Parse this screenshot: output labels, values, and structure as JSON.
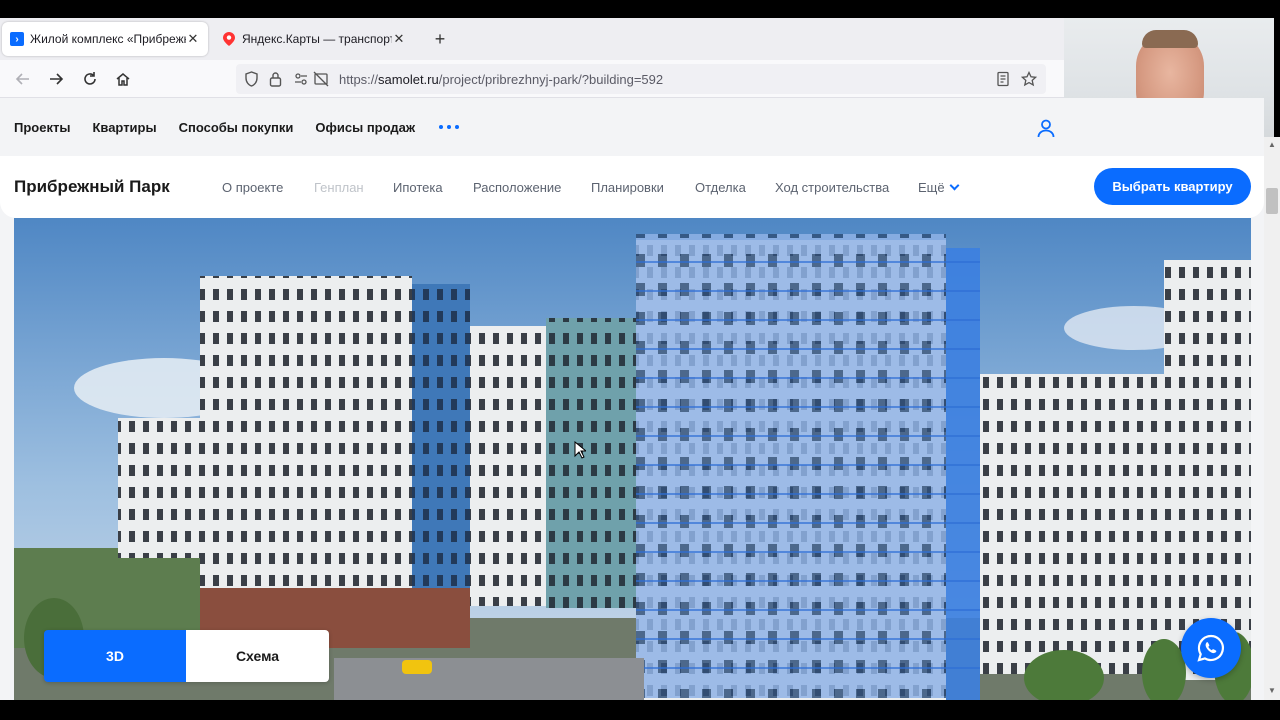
{
  "browser": {
    "tabs": [
      {
        "title": "Жилой комплекс «Прибрежн",
        "active": true,
        "favicon": "samolet-icon"
      },
      {
        "title": "Яндекс.Карты — транспорт, на",
        "active": false,
        "favicon": "map-pin-icon"
      }
    ],
    "url": {
      "scheme": "https://",
      "host": "samolet.ru",
      "path": "/project/pribrezhnyj-park/?building=592"
    }
  },
  "site_nav": {
    "items": [
      "Проекты",
      "Квартиры",
      "Способы покупки",
      "Офисы продаж"
    ]
  },
  "project_nav": {
    "title": "Прибрежный Парк",
    "items": [
      {
        "label": "О проекте",
        "dim": false
      },
      {
        "label": "Генплан",
        "dim": true
      },
      {
        "label": "Ипотека",
        "dim": false
      },
      {
        "label": "Расположение",
        "dim": false
      },
      {
        "label": "Планировки",
        "dim": false
      },
      {
        "label": "Отделка",
        "dim": false
      },
      {
        "label": "Ход строительства",
        "dim": false
      },
      {
        "label": "Ещё",
        "dim": false
      }
    ],
    "cta_label": "Выбрать квартиру"
  },
  "view_toggle": {
    "option_3d": "3D",
    "option_scheme": "Схема",
    "selected": "3D"
  },
  "colors": {
    "accent": "#0a6cff",
    "highlight": "#3c7fe0"
  }
}
